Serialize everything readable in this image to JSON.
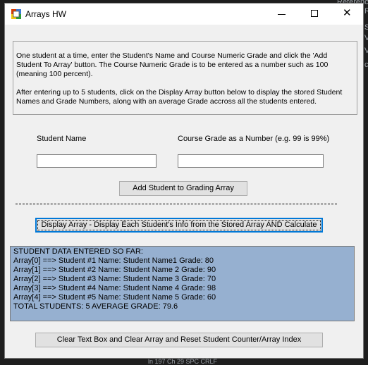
{
  "background": {
    "top_text": "Referenc",
    "right_letters": [
      "R",
      "S",
      "V",
      "V",
      "c"
    ],
    "bottom_text": "ln 197   Ch 29   SPC   CRLF"
  },
  "window": {
    "title": "Arrays HW",
    "controls": {
      "minimize": "minimize-icon",
      "maximize": "maximize-icon",
      "close": "close-icon"
    }
  },
  "instructions": {
    "paragraph1": "One student at a time, enter the Student's Name and Course Numeric Grade and click the 'Add Student To Array' button. The Course Numeric Grade is to be entered as a number such as 100 (meaning 100 percent).",
    "paragraph2": "After entering up to 5 students, click on the Display Array button below to display the stored Student Names and Grade Numbers, along with an average Grade accross all the students entered."
  },
  "form": {
    "student_name_label": "Student Name",
    "student_name_value": "",
    "grade_label": "Course Grade as a Number (e.g. 99 is 99%)",
    "grade_value": ""
  },
  "buttons": {
    "add": "Add Student to Grading Array",
    "display": "Display Array - Display Each Student's Info from the Stored Array AND Calculate",
    "clear": "Clear Text Box and Clear Array and Reset Student Counter/Array Index"
  },
  "output": {
    "lines": [
      "STUDENT DATA ENTERED SO FAR:",
      "Array[0] ==> Student #1   Name: Student Name1   Grade: 80",
      "Array[1] ==> Student #2   Name: Student Name 2   Grade: 90",
      "Array[2] ==> Student #3   Name: Student Name 3   Grade: 70",
      "Array[3] ==> Student #4   Name: Student Name 4   Grade: 98",
      "Array[4] ==> Student #5   Name: Student Name 5   Grade: 60",
      "TOTAL STUDENTS: 5   AVERAGE GRADE: 79.6"
    ]
  },
  "colors": {
    "output_bg": "#96b0d0",
    "focus_border": "#0078d7"
  }
}
